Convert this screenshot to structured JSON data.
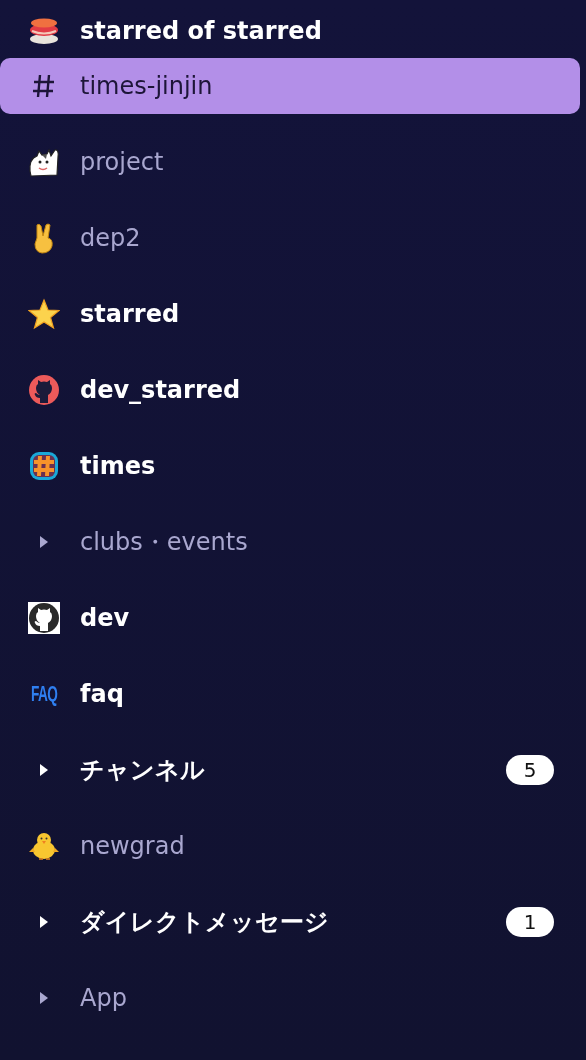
{
  "sidebar": {
    "items": [
      {
        "kind": "channel",
        "label": "starred of starred",
        "unread": true,
        "selected": false
      },
      {
        "kind": "channel",
        "label": "times-jinjin",
        "unread": false,
        "selected": true
      },
      {
        "kind": "channel",
        "label": "project",
        "unread": false,
        "selected": false
      },
      {
        "kind": "channel",
        "label": "dep2",
        "unread": false,
        "selected": false
      },
      {
        "kind": "channel",
        "label": "starred",
        "unread": true,
        "selected": false
      },
      {
        "kind": "channel",
        "label": "dev_starred",
        "unread": true,
        "selected": false
      },
      {
        "kind": "channel",
        "label": "times",
        "unread": true,
        "selected": false
      },
      {
        "kind": "section",
        "label": "clubs・events",
        "unread": false,
        "selected": false,
        "expanded": false
      },
      {
        "kind": "channel",
        "label": "dev",
        "unread": true,
        "selected": false
      },
      {
        "kind": "channel",
        "label": "faq",
        "unread": true,
        "selected": false,
        "icon_text": "FAQ"
      },
      {
        "kind": "section",
        "label": "チャンネル",
        "unread": true,
        "selected": false,
        "expanded": false,
        "badge": "5"
      },
      {
        "kind": "channel",
        "label": "newgrad",
        "unread": false,
        "selected": false
      },
      {
        "kind": "section",
        "label": "ダイレクトメッセージ",
        "unread": true,
        "selected": false,
        "expanded": false,
        "badge": "1"
      },
      {
        "kind": "section",
        "label": "App",
        "unread": false,
        "selected": false,
        "expanded": false
      }
    ]
  }
}
